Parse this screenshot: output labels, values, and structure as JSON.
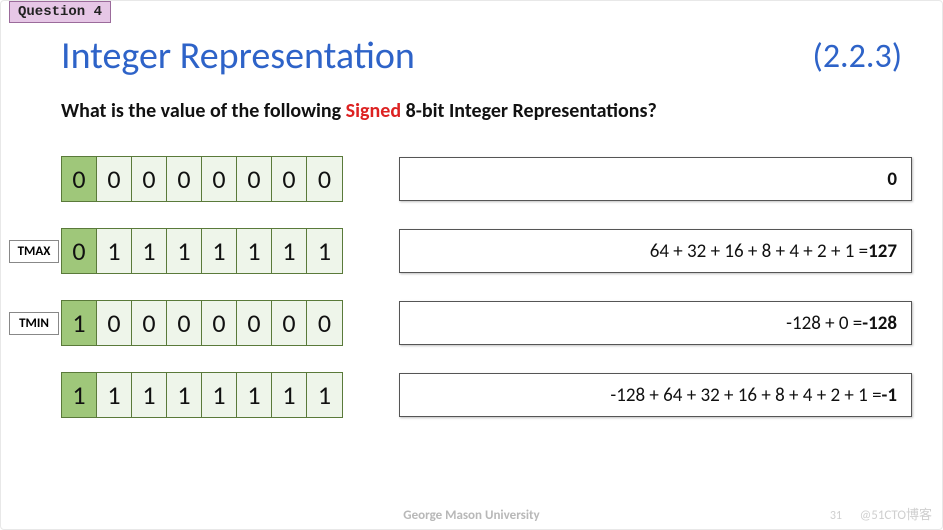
{
  "qtag": "Question 4",
  "title": "Integer Representation",
  "section": "(2.2.3)",
  "question_pre": "What is the value of the following ",
  "question_signed": "Signed",
  "question_post": " 8-bit Integer Representations?",
  "rows": [
    {
      "label": "",
      "bits": [
        "0",
        "0",
        "0",
        "0",
        "0",
        "0",
        "0",
        "0"
      ],
      "answer_calc": "",
      "answer_result": "0"
    },
    {
      "label": "TMAX",
      "bits": [
        "0",
        "1",
        "1",
        "1",
        "1",
        "1",
        "1",
        "1"
      ],
      "answer_calc": "64 + 32 + 16 + 8 + 4 + 2 + 1 = ",
      "answer_result": "127"
    },
    {
      "label": "TMIN",
      "bits": [
        "1",
        "0",
        "0",
        "0",
        "0",
        "0",
        "0",
        "0"
      ],
      "answer_calc": "-128 + 0 = ",
      "answer_result": "-128"
    },
    {
      "label": "",
      "bits": [
        "1",
        "1",
        "1",
        "1",
        "1",
        "1",
        "1",
        "1"
      ],
      "answer_calc": "-128 + 64 + 32 + 16 + 8 + 4 + 2 + 1 = ",
      "answer_result": "-1"
    }
  ],
  "footer": "George Mason University",
  "pagenum": "31",
  "watermark": "@51CTO博客"
}
